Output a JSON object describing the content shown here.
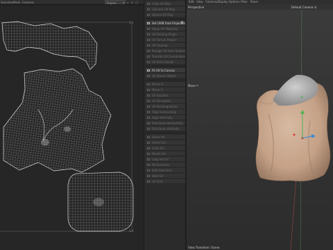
{
  "uv_editor": {
    "menu": [
      "Selection",
      "Mesh",
      "Features"
    ],
    "dropdown_value": "Project",
    "tools": "⌕ ↕ ▢",
    "corner_top_right": "1,1",
    "corner_bottom_right": "1,0"
  },
  "palette": {
    "items": [
      {
        "label": "Cube UV Map",
        "bright": false
      },
      {
        "label": "Cylinder UV Map",
        "bright": false
      },
      {
        "label": "Sphere UV Map",
        "bright": false
      },
      {
        "label": "Set UVW from Projection",
        "bright": true,
        "gear": true
      },
      {
        "label": "Apply UV Mapping",
        "bright": false
      },
      {
        "label": "UV Packing Plugin",
        "bright": false
      },
      {
        "label": "UV Terrain Project",
        "bright": false
      },
      {
        "label": "UV Unwrap",
        "bright": false
      },
      {
        "label": "Realign UV from Selection",
        "bright": false
      },
      {
        "label": "Transfer UV Coordinates",
        "bright": false
      },
      {
        "label": "UV Pack Islands",
        "bright": false
      },
      {
        "label": "Fit UV to Canvas",
        "bright": true
      },
      {
        "label": "UV Seams Object",
        "bright": false
      },
      {
        "label": "Mirror U",
        "bright": false
      },
      {
        "label": "Mirror V",
        "bright": false
      },
      {
        "label": "UV Equalize",
        "bright": false
      },
      {
        "label": "UV Straighten",
        "bright": false
      },
      {
        "label": "UV Rectangularize",
        "bright": false
      },
      {
        "label": "Align Horizontally",
        "bright": false
      },
      {
        "label": "Align Vertically",
        "bright": false
      },
      {
        "label": "Distribute Horizontally",
        "bright": false
      },
      {
        "label": "Distribute Vertically",
        "bright": false
      },
      {
        "label": "Select All",
        "bright": false
      },
      {
        "label": "Select Sel",
        "bright": false
      },
      {
        "label": "Grow Sel",
        "bright": false
      },
      {
        "label": "Shrink Sel",
        "bright": false
      },
      {
        "label": "Loop Sel UV",
        "bright": false
      },
      {
        "label": "Fill Selection",
        "bright": false
      },
      {
        "label": "Path Selection",
        "bright": false
      },
      {
        "label": "Hide Sel",
        "bright": false
      },
      {
        "label": "UV Grid",
        "bright": false
      }
    ]
  },
  "viewport": {
    "menu": [
      "Edit",
      "View",
      "Cameras",
      "Display",
      "Options",
      "Filter",
      "Panel"
    ],
    "view_name": "Perspective",
    "camera": "Default Camera ⇅",
    "move_label": "Move ↶",
    "status": "View Transform: Scene"
  }
}
